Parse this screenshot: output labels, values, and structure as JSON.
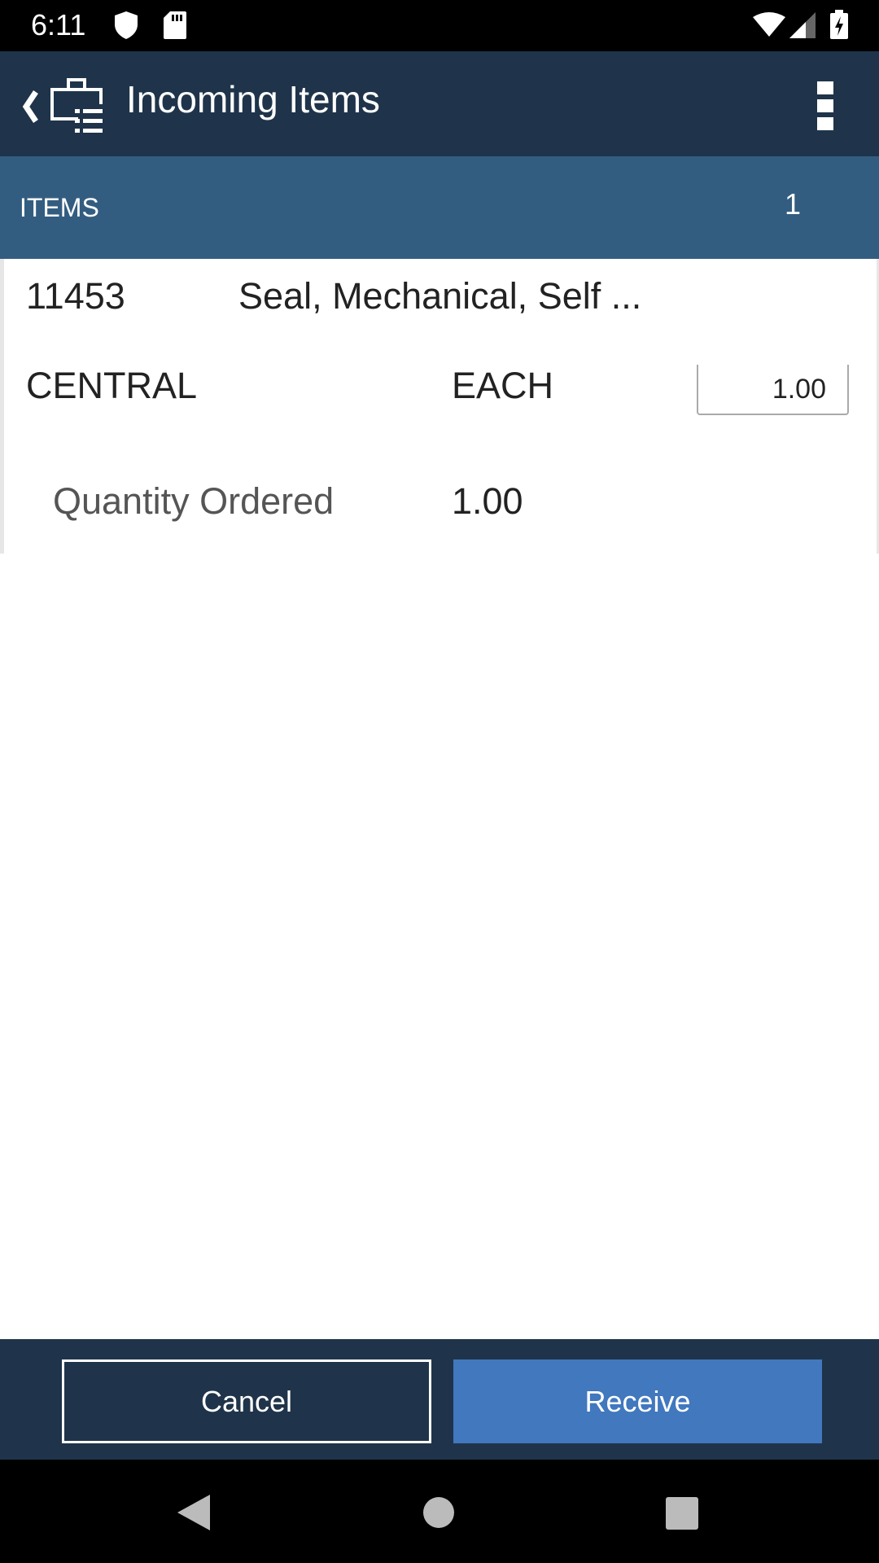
{
  "status_bar": {
    "time": "6:11",
    "icons": [
      "shield-icon",
      "sd-card-icon",
      "wifi-icon",
      "signal-icon",
      "battery-charging-icon"
    ]
  },
  "header": {
    "title": "Incoming Items",
    "back_icon": "chevron-left-icon",
    "app_icon": "briefcase-list-icon",
    "menu_icon": "more-vertical-icon"
  },
  "items_bar": {
    "label": "ITEMS",
    "count": "1"
  },
  "item": {
    "number": "11453",
    "description": "Seal, Mechanical, Self ...",
    "storeroom": "CENTRAL",
    "unit": "EACH",
    "quantity_input": "1.00",
    "quantity_ordered_label": "Quantity Ordered",
    "quantity_ordered_value": "1.00"
  },
  "footer": {
    "cancel_label": "Cancel",
    "receive_label": "Receive"
  },
  "colors": {
    "header": "#1f344a",
    "items_bar": "#335d80",
    "receive_button": "#4178be"
  },
  "nav": {
    "icons": [
      "back-icon",
      "home-icon",
      "recents-icon"
    ]
  }
}
